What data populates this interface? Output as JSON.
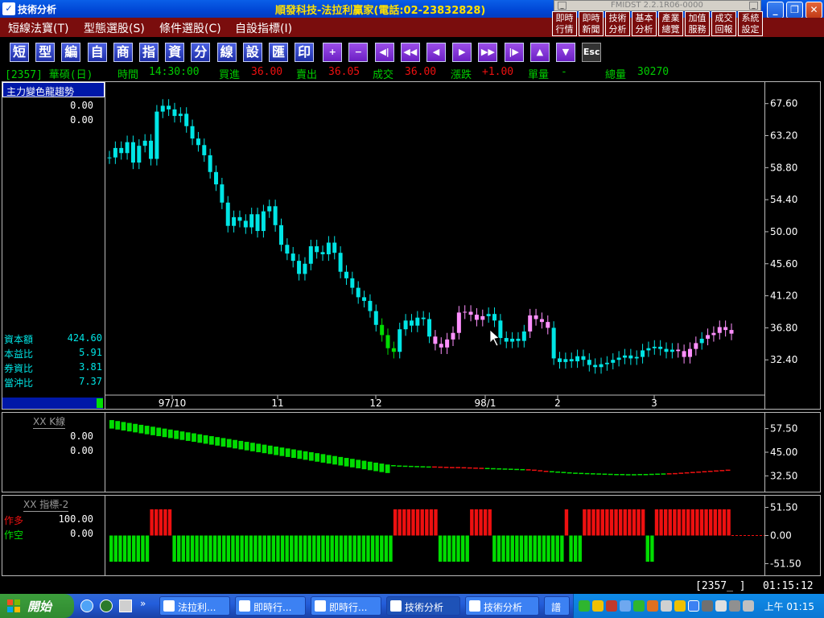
{
  "window": {
    "title": "技術分析",
    "brand": "順發科技-法拉利贏家(電話:02-23832828)"
  },
  "mini_window": {
    "title": "FMIDST 2.2.1R06-0000"
  },
  "menu": [
    {
      "label": "短線法寶(T)"
    },
    {
      "label": "型態選股(S)"
    },
    {
      "label": "條件選股(C)"
    },
    {
      "label": "自設指標(I)"
    }
  ],
  "quick_buttons": [
    {
      "label": "即時\n行情"
    },
    {
      "label": "即時\n新聞"
    },
    {
      "label": "技術\n分析"
    },
    {
      "label": "基本\n分析"
    },
    {
      "label": "產業\n總覽"
    },
    {
      "label": "加值\n服務"
    },
    {
      "label": "成交\n回報"
    },
    {
      "label": "系統\n設定"
    }
  ],
  "toolbar": [
    {
      "label": "短",
      "name": "short-button"
    },
    {
      "label": "型",
      "name": "pattern-button"
    },
    {
      "label": "編",
      "name": "edit-button"
    },
    {
      "label": "自",
      "name": "self-button"
    },
    {
      "label": "商",
      "name": "commodity-button"
    },
    {
      "label": "指",
      "name": "indicator-button"
    },
    {
      "label": "資",
      "name": "data-button"
    },
    {
      "label": "分",
      "name": "split-button"
    },
    {
      "label": "線",
      "name": "line-button"
    },
    {
      "label": "設",
      "name": "settings-button"
    },
    {
      "label": "匯",
      "name": "export-button"
    },
    {
      "label": "印",
      "name": "print-button"
    },
    {
      "label": "+",
      "name": "zoom-in-button",
      "nav": true
    },
    {
      "label": "−",
      "name": "zoom-out-button",
      "nav": true
    },
    {
      "label": "◀|",
      "name": "first-button",
      "nav": true
    },
    {
      "label": "◀◀",
      "name": "fast-back-button",
      "nav": true
    },
    {
      "label": "◀",
      "name": "back-button",
      "nav": true
    },
    {
      "label": "▶",
      "name": "forward-button",
      "nav": true
    },
    {
      "label": "▶▶",
      "name": "fast-forward-button",
      "nav": true
    },
    {
      "label": "|▶",
      "name": "last-button",
      "nav": true
    },
    {
      "label": "▲",
      "name": "up-button",
      "nav": true
    },
    {
      "label": "▼",
      "name": "down-button",
      "nav": true
    },
    {
      "label": "Esc",
      "name": "esc-button",
      "esc": true
    }
  ],
  "quote": {
    "code": "[2357] 華碩(日)",
    "time_label": "時間",
    "time": "14:30:00",
    "bid_label": "買進",
    "bid": "36.00",
    "ask_label": "賣出",
    "ask": "36.05",
    "deal_label": "成交",
    "deal": "36.00",
    "change_label": "漲跌",
    "change": "+1.00",
    "vol_label": "單量",
    "vol": "-",
    "total_label": "總量",
    "total": "30270"
  },
  "colors": {
    "up": "#00e5e5",
    "down": "#00e5e5",
    "pink": "#ff90ff",
    "green": "#00dd00",
    "red": "#ee1010",
    "yellow": "#ffff00"
  },
  "main_panel": {
    "title": "主力變色龍趨勢",
    "values": [
      "0.00",
      "0.00"
    ],
    "stats": [
      {
        "label": "資本額",
        "value": "424.60"
      },
      {
        "label": "本益比",
        "value": "5.91"
      },
      {
        "label": "券資比",
        "value": "3.81"
      },
      {
        "label": "當沖比",
        "value": "7.37"
      }
    ],
    "y_ticks": [
      "67.60",
      "63.20",
      "58.80",
      "54.40",
      "50.00",
      "45.60",
      "41.20",
      "36.80",
      "32.40"
    ],
    "x_ticks": [
      "97/10",
      "11",
      "12",
      "98/1",
      "2",
      "3"
    ]
  },
  "k_panel": {
    "title": "XX K線",
    "values": [
      "0.00",
      "0.00"
    ],
    "y_ticks": [
      "57.50",
      "45.00",
      "32.50"
    ]
  },
  "ind_panel": {
    "title": "XX 指標-2",
    "long_label": "作多",
    "long_value": "100.00",
    "short_label": "作空",
    "short_value": "0.00",
    "y_ticks": [
      "51.50",
      "0.00",
      "-51.50"
    ]
  },
  "status": {
    "code": "[2357_ ]",
    "time": "01:15:12"
  },
  "taskbar": {
    "start": "開始",
    "tasks": [
      {
        "label": "法拉利..."
      },
      {
        "label": "即時行..."
      },
      {
        "label": "即時行..."
      },
      {
        "label": "技術分析"
      },
      {
        "label": "技術分析"
      },
      {
        "label": "譜"
      }
    ],
    "clock": "上午 01:15"
  },
  "chart_data": [
    {
      "type": "candlestick",
      "title": "主力變色龍趨勢",
      "x_ticks": [
        "97/10",
        "11",
        "12",
        "98/1",
        "2",
        "3"
      ],
      "ylim": [
        28.0,
        70.0
      ],
      "y_ticks": [
        67.6,
        63.2,
        58.8,
        54.4,
        50.0,
        45.6,
        41.2,
        36.8,
        32.4
      ],
      "series": [
        {
          "name": "",
          "values": [
            60.2,
            61.5,
            60.8,
            62.3,
            59.5,
            61.8,
            62.5,
            60.0,
            66.5,
            67.3,
            66.8,
            65.9,
            66.2,
            64.5,
            62.8,
            61.9,
            60.5,
            58.2,
            56.5,
            54.0,
            50.8,
            52.0,
            51.5,
            50.6,
            52.4,
            50.1,
            52.8,
            53.5,
            50.9,
            48.2,
            47.0,
            46.0,
            44.2,
            45.6,
            48.0,
            47.2,
            46.9,
            48.5,
            47.1,
            44.5,
            43.6,
            42.3,
            41.0,
            40.5,
            39.1,
            37.2,
            35.8,
            34.0,
            33.5,
            36.6,
            37.8,
            37.1,
            38.2,
            38.0,
            35.6,
            34.6,
            34.1,
            35.2,
            36.1,
            38.9,
            39.0,
            38.6,
            37.9,
            38.4,
            38.7,
            37.8,
            35.4,
            34.9,
            35.3,
            35.0,
            36.3,
            38.5,
            38.0,
            37.6,
            36.8,
            32.6,
            32.1,
            32.5,
            32.2,
            32.9,
            32.4,
            31.7,
            31.4,
            31.8,
            32.0,
            32.4,
            32.7,
            33.0,
            32.6,
            32.8,
            33.7,
            34.0,
            34.2,
            33.9,
            33.5,
            33.8,
            33.6,
            32.8,
            33.9,
            34.7,
            35.3,
            35.8,
            36.1,
            36.9,
            36.5,
            36.0
          ]
        }
      ]
    },
    {
      "type": "bar",
      "title": "XX K線",
      "ylim": [
        25.0,
        65.0
      ],
      "y_ticks": [
        57.5,
        45.0,
        32.5
      ],
      "series": [
        {
          "name": "",
          "values": [
            62,
            61.5,
            61,
            60.5,
            60,
            59.5,
            59,
            58.5,
            58,
            57.5,
            57,
            56.5,
            56,
            55.5,
            55,
            54.5,
            54,
            53.5,
            53,
            52.5,
            52,
            51.5,
            51,
            50.5,
            50,
            49.5,
            49,
            48.5,
            48,
            47.5,
            47,
            46.5,
            46,
            45.5,
            45,
            44.5,
            44,
            43.5,
            43,
            42.5,
            42,
            41.5,
            41,
            40.5,
            40,
            39.5,
            39,
            38.5,
            38.2,
            38.0,
            37.9,
            37.8,
            37.7,
            37.6,
            37.5,
            37.5,
            37.4,
            37.3,
            37.2,
            37.2,
            37.1,
            37.0,
            36.9,
            36.8,
            36.7,
            36.6,
            36.5,
            36.4,
            36.3,
            36.2,
            36.1,
            36.0,
            35.8,
            35.5,
            35.2,
            35.0,
            34.8,
            34.6,
            34.4,
            34.2,
            34.1,
            34.0,
            33.9,
            33.8,
            33.7,
            33.6,
            33.5,
            33.5,
            33.4,
            33.4,
            33.5,
            33.5,
            33.6,
            33.7,
            33.8,
            33.9,
            34.0,
            34.2,
            34.4,
            34.6,
            34.8,
            35.0,
            35.2,
            35.4,
            35.6,
            35.8
          ]
        }
      ]
    },
    {
      "type": "bar",
      "title": "XX 指標-2",
      "ylim": [
        -70,
        70
      ],
      "y_ticks": [
        51.5,
        0.0,
        -51.5
      ],
      "series": [
        {
          "name": "",
          "values": [
            -100,
            -100,
            -100,
            -100,
            -100,
            -100,
            -100,
            -100,
            -100,
            100,
            100,
            100,
            100,
            100,
            -100,
            -100,
            -100,
            -100,
            -100,
            -100,
            -100,
            -100,
            -100,
            -100,
            -100,
            -100,
            -100,
            -100,
            -100,
            -100,
            -100,
            -100,
            -100,
            -100,
            -100,
            -100,
            -100,
            -100,
            -100,
            -100,
            -100,
            -100,
            -100,
            -100,
            -100,
            -100,
            -100,
            -100,
            -100,
            -100,
            -100,
            -100,
            -100,
            -100,
            -100,
            -100,
            -100,
            -100,
            -100,
            -100,
            -100,
            -100,
            -100,
            100,
            100,
            100,
            100,
            100,
            100,
            100,
            100,
            100,
            100,
            -100,
            -100,
            -100,
            -100,
            -100,
            -100,
            -100,
            100,
            100,
            100,
            100,
            100,
            -100,
            -100,
            -100,
            -100,
            -100,
            -100,
            -100,
            -100,
            -100,
            -100,
            -100,
            -100,
            -100,
            -100,
            -100,
            -100,
            100,
            -100,
            -100,
            -100,
            100,
            100,
            100,
            100,
            100,
            100,
            100,
            100,
            100,
            100,
            100,
            100,
            100,
            100,
            -100,
            -100,
            100,
            100,
            100,
            100,
            100,
            100,
            100,
            100,
            100,
            100,
            100,
            100,
            100,
            100,
            100,
            100,
            100
          ]
        }
      ]
    }
  ]
}
